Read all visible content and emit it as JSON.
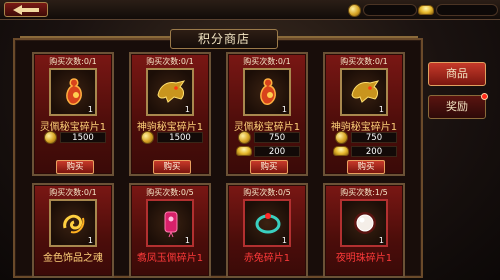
{
  "top_bar": {
    "currency_icons": [
      "coin-icon",
      "gold-ingot-icon"
    ]
  },
  "panel": {
    "title": "积分商店"
  },
  "tabs": [
    {
      "label": "商品",
      "active": true
    },
    {
      "label": "奖励",
      "active": false,
      "badge": true
    }
  ],
  "items": [
    {
      "count": "购买次数:0/1",
      "qty": "1",
      "name": "灵佩秘宝碎片1",
      "icon": "gourd-icon",
      "name_color": "gold",
      "prices": [
        {
          "icon": "token-icon",
          "value": "1500"
        }
      ],
      "buy_label": "购买"
    },
    {
      "count": "购买次数:0/1",
      "qty": "1",
      "name": "神驹秘宝碎片1",
      "icon": "dragon-head-icon",
      "name_color": "gold",
      "prices": [
        {
          "icon": "token-icon",
          "value": "1500"
        }
      ],
      "buy_label": "购买"
    },
    {
      "count": "购买次数:0/1",
      "qty": "1",
      "name": "灵佩秘宝碎片1",
      "icon": "gourd-icon",
      "name_color": "gold",
      "prices": [
        {
          "icon": "token-icon",
          "value": "750"
        },
        {
          "icon": "gold-ingot-icon",
          "value": "200"
        }
      ],
      "buy_label": "购买"
    },
    {
      "count": "购买次数:0/1",
      "qty": "1",
      "name": "神驹秘宝碎片1",
      "icon": "dragon-head-icon",
      "name_color": "gold",
      "prices": [
        {
          "icon": "token-icon",
          "value": "750"
        },
        {
          "icon": "gold-ingot-icon",
          "value": "200"
        }
      ],
      "buy_label": "购买"
    },
    {
      "count": "购买次数:0/1",
      "qty": "1",
      "name": "金色饰品之魂",
      "icon": "gold-swirl-icon",
      "name_color": "gold"
    },
    {
      "count": "购买次数:0/5",
      "qty": "1",
      "name": "翥凤玉佩碎片1",
      "icon": "jade-pendant-icon",
      "name_color": "red"
    },
    {
      "count": "购买次数:0/5",
      "qty": "1",
      "name": "赤兔碎片1",
      "icon": "ring-icon",
      "name_color": "red"
    },
    {
      "count": "购买次数:1/5",
      "qty": "1",
      "name": "夜明珠碎片1",
      "icon": "pearl-icon",
      "name_color": "red"
    }
  ]
}
